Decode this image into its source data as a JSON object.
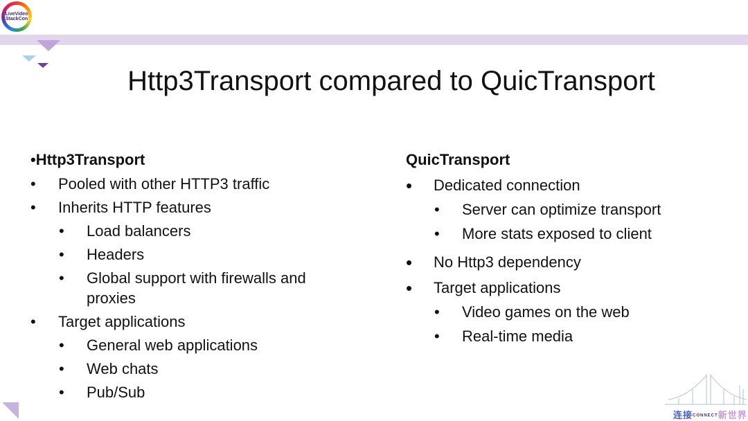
{
  "logo": {
    "text_line1": "LiveVideo",
    "text_line2": "StackCon"
  },
  "title": "Http3Transport compared to QuicTransport",
  "left_column": {
    "heading_bullet": "•",
    "heading": "Http3Transport",
    "items": [
      {
        "level": 1,
        "text": "Pooled with other HTTP3 traffic"
      },
      {
        "level": 1,
        "text": "Inherits HTTP features"
      },
      {
        "level": 2,
        "text": "Load balancers"
      },
      {
        "level": 2,
        "text": "Headers"
      },
      {
        "level": 2,
        "text": "Global support with firewalls and proxies"
      },
      {
        "level": 1,
        "text": "Target applications"
      },
      {
        "level": 2,
        "text": "General web applications"
      },
      {
        "level": 2,
        "text": "Web chats"
      },
      {
        "level": 2,
        "text": "Pub/Sub"
      }
    ]
  },
  "right_column": {
    "heading": "QuicTransport",
    "items": [
      {
        "level": 1,
        "text": "Dedicated connection"
      },
      {
        "level": 2,
        "text": "Server can optimize transport"
      },
      {
        "level": 2,
        "text": "More stats exposed to client"
      },
      {
        "level": 1,
        "text": "No Http3 dependency"
      },
      {
        "level": 1,
        "text": "Target applications"
      },
      {
        "level": 2,
        "text": "Video games on the web"
      },
      {
        "level": 2,
        "text": "Real-time media"
      }
    ]
  },
  "footer_logo": {
    "text_cn1": "连接",
    "text_en": "CONNECT",
    "text_cn2": "新世界"
  },
  "colors": {
    "band": "#e2d6ec",
    "accent_purple": "#6b3fa0",
    "text": "#111111"
  }
}
